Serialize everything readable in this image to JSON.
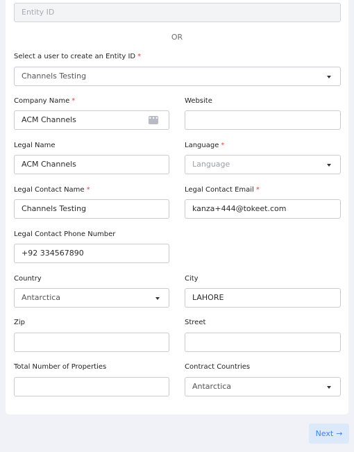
{
  "entity_id": {
    "placeholder": "Entity ID"
  },
  "or_text": "OR",
  "select_user": {
    "label": "Select a user to create an Entity ID",
    "value": "Channels Testing"
  },
  "company_name": {
    "label": "Company Name",
    "value": "ACM Channels"
  },
  "website": {
    "label": "Website",
    "value": ""
  },
  "legal_name": {
    "label": "Legal Name",
    "value": "ACM Channels"
  },
  "language": {
    "label": "Language",
    "placeholder": "Language"
  },
  "legal_contact_name": {
    "label": "Legal Contact Name",
    "value": "Channels Testing"
  },
  "legal_contact_email": {
    "label": "Legal Contact Email",
    "value": "kanza+444@tokeet.com"
  },
  "legal_contact_phone": {
    "label": "Legal Contact Phone Number",
    "value": "+92 334567890"
  },
  "country": {
    "label": "Country",
    "value": "Antarctica"
  },
  "city": {
    "label": "City",
    "value": "LAHORE"
  },
  "zip": {
    "label": "Zip",
    "value": ""
  },
  "street": {
    "label": "Street",
    "value": ""
  },
  "total_properties": {
    "label": "Total Number of Properties",
    "value": ""
  },
  "contract_countries": {
    "label": "Contract Countries",
    "value": "Antarctica"
  },
  "required_marker": "*",
  "next_button": {
    "label": "Next",
    "arrow": "→"
  },
  "icons": {
    "dots": "more-dots-icon",
    "caret": "caret-down-icon",
    "arrow": "arrow-right-icon"
  },
  "colors": {
    "background": "#f1f2f8",
    "required": "#e0463b",
    "button_bg": "#dbe9fb",
    "button_text": "#3e82e6"
  }
}
